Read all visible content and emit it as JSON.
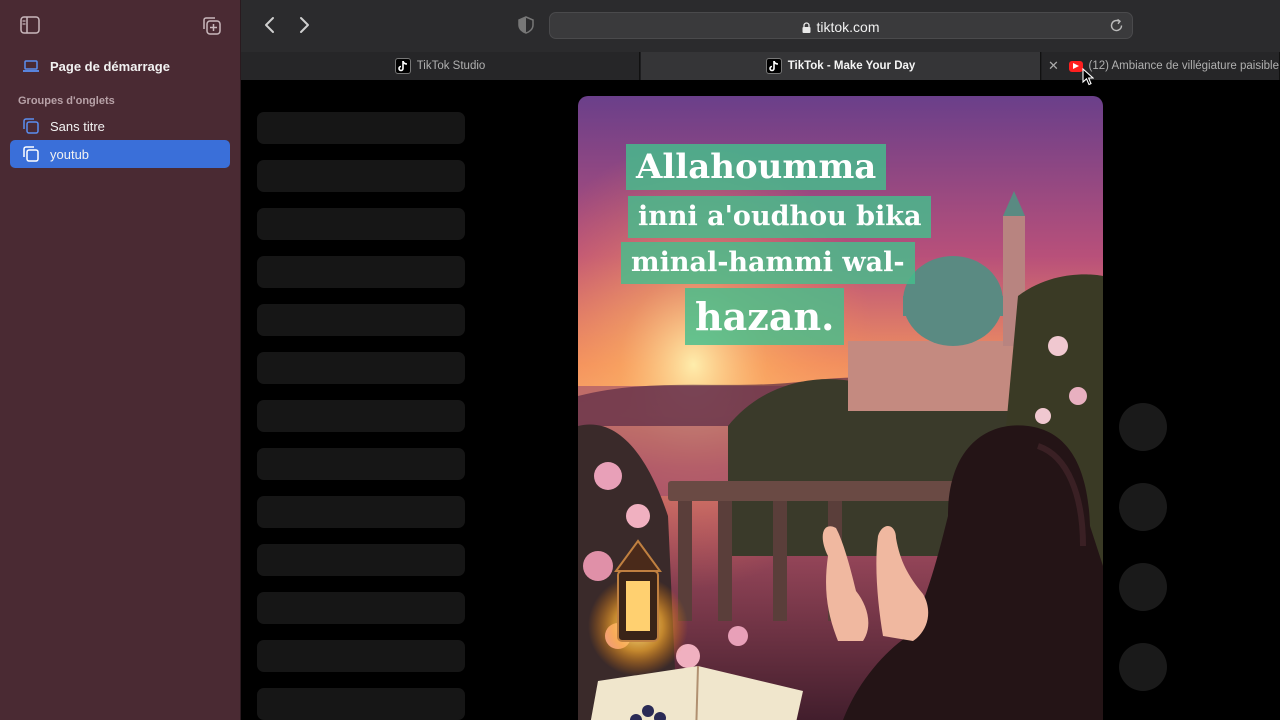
{
  "sidebar": {
    "start_page": "Page de démarrage",
    "groups_heading": "Groupes d'onglets",
    "groups": [
      {
        "label": "Sans titre",
        "selected": false
      },
      {
        "label": "youtub",
        "selected": true
      }
    ]
  },
  "toolbar": {
    "url": "tiktok.com"
  },
  "tabs": [
    {
      "label": "TikTok Studio",
      "active": false,
      "icon": "tiktok-icon"
    },
    {
      "label": "TikTok - Make Your Day",
      "active": true,
      "icon": "tiktok-icon"
    },
    {
      "label": "(12) Ambiance de villégiature paisible",
      "active": false,
      "icon": "youtube-icon"
    }
  ],
  "video": {
    "caption_lines": [
      "Allahoumma",
      "inni a'oudhou bika",
      "minal-hammi wal-",
      "hazan."
    ]
  },
  "colors": {
    "sidebar_bg": "#4a2a33",
    "selected_accent": "#3a6fd9",
    "caption_bg": "#44be8c"
  }
}
